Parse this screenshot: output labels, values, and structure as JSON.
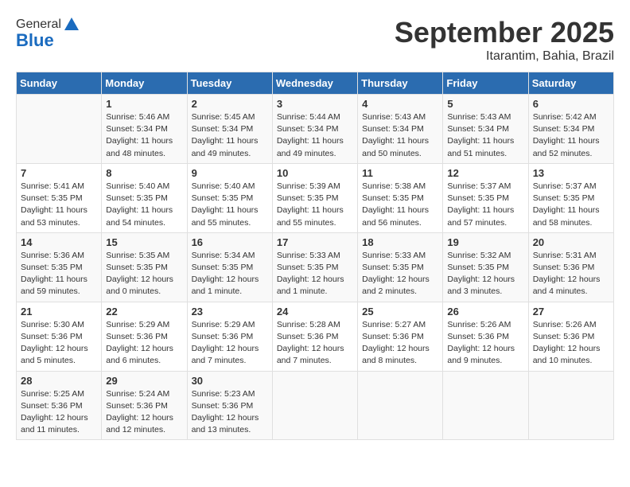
{
  "header": {
    "logo_general": "General",
    "logo_blue": "Blue",
    "month_title": "September 2025",
    "location": "Itarantim, Bahia, Brazil"
  },
  "days_of_week": [
    "Sunday",
    "Monday",
    "Tuesday",
    "Wednesday",
    "Thursday",
    "Friday",
    "Saturday"
  ],
  "weeks": [
    [
      {
        "day": "",
        "info": ""
      },
      {
        "day": "1",
        "info": "Sunrise: 5:46 AM\nSunset: 5:34 PM\nDaylight: 11 hours\nand 48 minutes."
      },
      {
        "day": "2",
        "info": "Sunrise: 5:45 AM\nSunset: 5:34 PM\nDaylight: 11 hours\nand 49 minutes."
      },
      {
        "day": "3",
        "info": "Sunrise: 5:44 AM\nSunset: 5:34 PM\nDaylight: 11 hours\nand 49 minutes."
      },
      {
        "day": "4",
        "info": "Sunrise: 5:43 AM\nSunset: 5:34 PM\nDaylight: 11 hours\nand 50 minutes."
      },
      {
        "day": "5",
        "info": "Sunrise: 5:43 AM\nSunset: 5:34 PM\nDaylight: 11 hours\nand 51 minutes."
      },
      {
        "day": "6",
        "info": "Sunrise: 5:42 AM\nSunset: 5:34 PM\nDaylight: 11 hours\nand 52 minutes."
      }
    ],
    [
      {
        "day": "7",
        "info": "Sunrise: 5:41 AM\nSunset: 5:35 PM\nDaylight: 11 hours\nand 53 minutes."
      },
      {
        "day": "8",
        "info": "Sunrise: 5:40 AM\nSunset: 5:35 PM\nDaylight: 11 hours\nand 54 minutes."
      },
      {
        "day": "9",
        "info": "Sunrise: 5:40 AM\nSunset: 5:35 PM\nDaylight: 11 hours\nand 55 minutes."
      },
      {
        "day": "10",
        "info": "Sunrise: 5:39 AM\nSunset: 5:35 PM\nDaylight: 11 hours\nand 55 minutes."
      },
      {
        "day": "11",
        "info": "Sunrise: 5:38 AM\nSunset: 5:35 PM\nDaylight: 11 hours\nand 56 minutes."
      },
      {
        "day": "12",
        "info": "Sunrise: 5:37 AM\nSunset: 5:35 PM\nDaylight: 11 hours\nand 57 minutes."
      },
      {
        "day": "13",
        "info": "Sunrise: 5:37 AM\nSunset: 5:35 PM\nDaylight: 11 hours\nand 58 minutes."
      }
    ],
    [
      {
        "day": "14",
        "info": "Sunrise: 5:36 AM\nSunset: 5:35 PM\nDaylight: 11 hours\nand 59 minutes."
      },
      {
        "day": "15",
        "info": "Sunrise: 5:35 AM\nSunset: 5:35 PM\nDaylight: 12 hours\nand 0 minutes."
      },
      {
        "day": "16",
        "info": "Sunrise: 5:34 AM\nSunset: 5:35 PM\nDaylight: 12 hours\nand 1 minute."
      },
      {
        "day": "17",
        "info": "Sunrise: 5:33 AM\nSunset: 5:35 PM\nDaylight: 12 hours\nand 1 minute."
      },
      {
        "day": "18",
        "info": "Sunrise: 5:33 AM\nSunset: 5:35 PM\nDaylight: 12 hours\nand 2 minutes."
      },
      {
        "day": "19",
        "info": "Sunrise: 5:32 AM\nSunset: 5:35 PM\nDaylight: 12 hours\nand 3 minutes."
      },
      {
        "day": "20",
        "info": "Sunrise: 5:31 AM\nSunset: 5:36 PM\nDaylight: 12 hours\nand 4 minutes."
      }
    ],
    [
      {
        "day": "21",
        "info": "Sunrise: 5:30 AM\nSunset: 5:36 PM\nDaylight: 12 hours\nand 5 minutes."
      },
      {
        "day": "22",
        "info": "Sunrise: 5:29 AM\nSunset: 5:36 PM\nDaylight: 12 hours\nand 6 minutes."
      },
      {
        "day": "23",
        "info": "Sunrise: 5:29 AM\nSunset: 5:36 PM\nDaylight: 12 hours\nand 7 minutes."
      },
      {
        "day": "24",
        "info": "Sunrise: 5:28 AM\nSunset: 5:36 PM\nDaylight: 12 hours\nand 7 minutes."
      },
      {
        "day": "25",
        "info": "Sunrise: 5:27 AM\nSunset: 5:36 PM\nDaylight: 12 hours\nand 8 minutes."
      },
      {
        "day": "26",
        "info": "Sunrise: 5:26 AM\nSunset: 5:36 PM\nDaylight: 12 hours\nand 9 minutes."
      },
      {
        "day": "27",
        "info": "Sunrise: 5:26 AM\nSunset: 5:36 PM\nDaylight: 12 hours\nand 10 minutes."
      }
    ],
    [
      {
        "day": "28",
        "info": "Sunrise: 5:25 AM\nSunset: 5:36 PM\nDaylight: 12 hours\nand 11 minutes."
      },
      {
        "day": "29",
        "info": "Sunrise: 5:24 AM\nSunset: 5:36 PM\nDaylight: 12 hours\nand 12 minutes."
      },
      {
        "day": "30",
        "info": "Sunrise: 5:23 AM\nSunset: 5:36 PM\nDaylight: 12 hours\nand 13 minutes."
      },
      {
        "day": "",
        "info": ""
      },
      {
        "day": "",
        "info": ""
      },
      {
        "day": "",
        "info": ""
      },
      {
        "day": "",
        "info": ""
      }
    ]
  ]
}
